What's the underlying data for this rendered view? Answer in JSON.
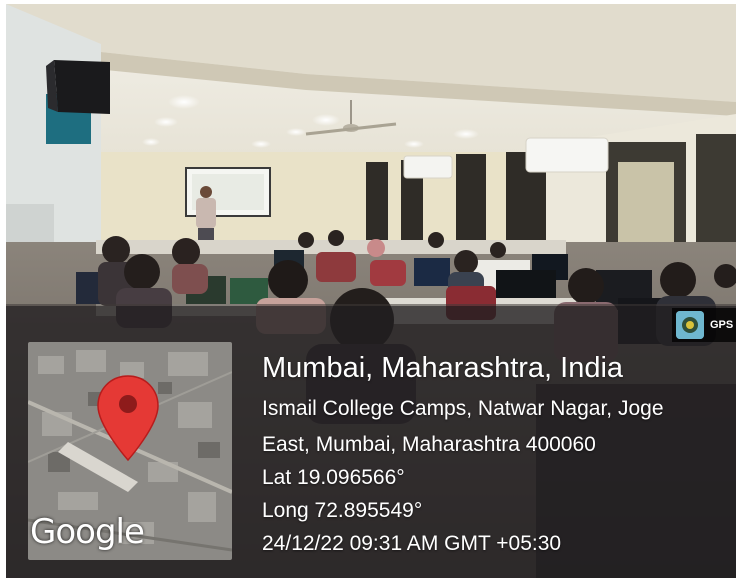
{
  "location": {
    "city_line": "Mumbai, Maharashtra, India",
    "address_line_1": "Ismail College Camps, Natwar Nagar, Joge",
    "address_line_2": "East, Mumbai, Maharashtra 400060",
    "latitude": "Lat 19.096566°",
    "longitude": "Long 72.895549°",
    "timestamp": "24/12/22 09:31 AM GMT +05:30"
  },
  "map": {
    "provider_logo": "Google",
    "pin_color": "#e53935"
  },
  "badge": {
    "label": "GPS",
    "icon": "gps-camera-app-icon"
  },
  "photo": {
    "subject": "computer lab session with instructor at projector screen",
    "icons": [
      "speaker-icon",
      "ceiling-fan-icon",
      "air-conditioner-icon",
      "projector-screen-icon"
    ]
  }
}
